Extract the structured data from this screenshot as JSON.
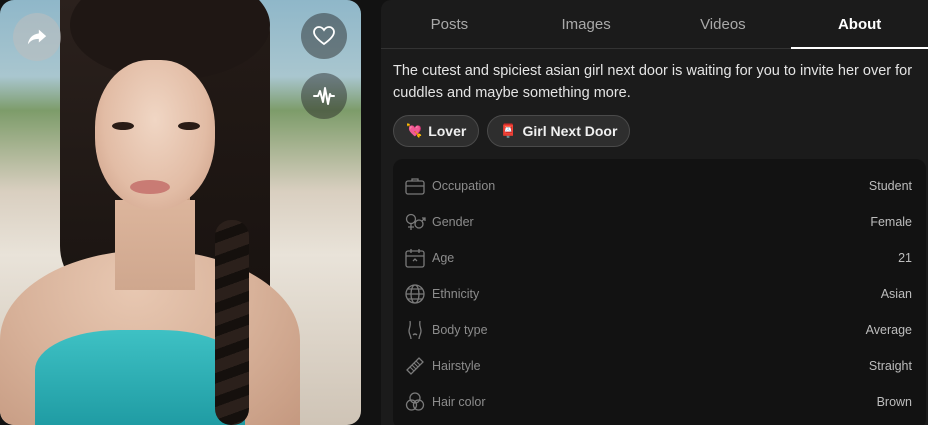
{
  "photo": {
    "share_icon": "share-arrow-icon",
    "like_icon": "heart-outline-icon",
    "voice_icon": "sound-wave-icon"
  },
  "tabs": [
    {
      "label": "Posts",
      "active": false
    },
    {
      "label": "Images",
      "active": false
    },
    {
      "label": "Videos",
      "active": false
    },
    {
      "label": "About",
      "active": true
    }
  ],
  "about": {
    "description": "The cutest and spiciest asian girl next door is waiting for you to invite her over for cuddles and maybe something more."
  },
  "tags": [
    {
      "emoji": "💘",
      "label": "Lover"
    },
    {
      "emoji": "📮",
      "label": "Girl Next Door"
    }
  ],
  "details": [
    {
      "icon": "briefcase-icon",
      "label": "Occupation",
      "value": "Student"
    },
    {
      "icon": "gender-icon",
      "label": "Gender",
      "value": "Female"
    },
    {
      "icon": "calendar-icon",
      "label": "Age",
      "value": "21"
    },
    {
      "icon": "globe-icon",
      "label": "Ethnicity",
      "value": "Asian"
    },
    {
      "icon": "body-icon",
      "label": "Body type",
      "value": "Average"
    },
    {
      "icon": "comb-icon",
      "label": "Hairstyle",
      "value": "Straight"
    },
    {
      "icon": "color-circles-icon",
      "label": "Hair color",
      "value": "Brown"
    }
  ]
}
